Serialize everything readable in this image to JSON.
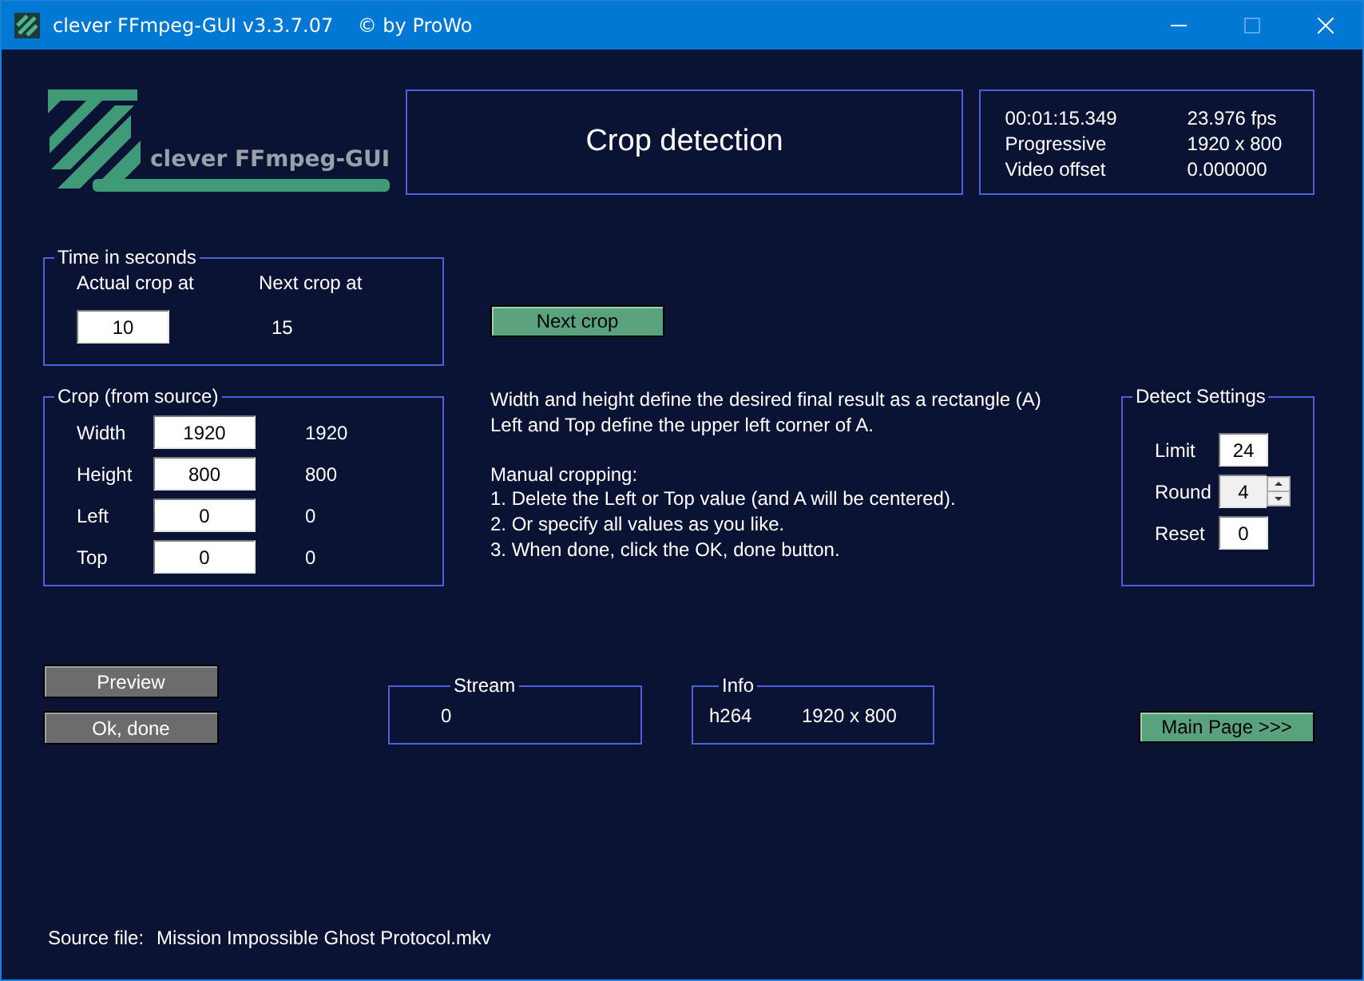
{
  "window": {
    "title": "clever FFmpeg-GUI v3.3.7.07    © by ProWo"
  },
  "logo": {
    "text": "clever FFmpeg-GUI"
  },
  "header": {
    "title": "Crop detection"
  },
  "media_info": [
    {
      "label": "00:01:15.349",
      "value": "23.976 fps"
    },
    {
      "label": "Progressive",
      "value": "1920 x 800"
    },
    {
      "label": "Video offset",
      "value": "0.000000"
    }
  ],
  "time_group": {
    "title": "Time in seconds",
    "actual_label": "Actual crop at",
    "next_label": "Next crop at",
    "actual_value": "10",
    "next_value": "15"
  },
  "next_crop_button": "Next crop",
  "crop_group": {
    "title": "Crop (from source)",
    "rows": [
      {
        "label": "Width",
        "value": "1920",
        "source": "1920"
      },
      {
        "label": "Height",
        "value": "800",
        "source": "800"
      },
      {
        "label": "Left",
        "value": "0",
        "source": "0"
      },
      {
        "label": "Top",
        "value": "0",
        "source": "0"
      }
    ]
  },
  "instructions": [
    [
      "Width and height define the desired final result as a rectangle (A)",
      "Left and Top define the upper left corner of A."
    ],
    [
      "Manual cropping:",
      "1. Delete the Left or Top value (and A will be centered).",
      "2. Or specify all values as you like.",
      "3. When done, click the OK, done button."
    ]
  ],
  "detect_settings": {
    "title": "Detect Settings",
    "fields": [
      {
        "label": "Limit",
        "value": "24",
        "kind": "text"
      },
      {
        "label": "Round",
        "value": "4",
        "kind": "spin"
      },
      {
        "label": "Reset",
        "value": "0",
        "kind": "text"
      }
    ]
  },
  "preview_button": "Preview",
  "ok_button": "Ok, done",
  "stream_group": {
    "title": "Stream",
    "value": "0"
  },
  "info_group": {
    "title": "Info",
    "codec": "h264",
    "resolution": "1920 x 800"
  },
  "main_page_button": "Main Page >>>",
  "source_file": {
    "label": "Source file:",
    "value": "Mission Impossible Ghost Protocol.mkv"
  }
}
